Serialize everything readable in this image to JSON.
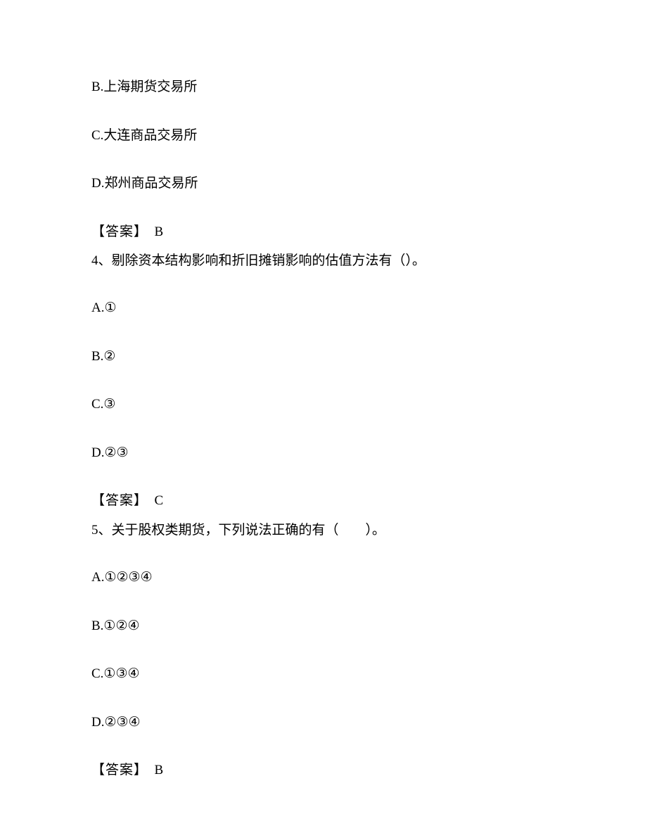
{
  "q3_remainder": {
    "options": {
      "b": "B.上海期货交易所",
      "c": "C.大连商品交易所",
      "d": "D.郑州商品交易所"
    },
    "answer_label": "【答案】",
    "answer_value": "B"
  },
  "q4": {
    "stem": "4、剔除资本结构影响和折旧摊销影响的估值方法有（）。",
    "options": {
      "a": "A.①",
      "b": "B.②",
      "c": "C.③",
      "d": "D.②③"
    },
    "answer_label": "【答案】",
    "answer_value": "C"
  },
  "q5": {
    "stem": "5、关于股权类期货，下列说法正确的有（　　）。",
    "options": {
      "a": "A.①②③④",
      "b": "B.①②④",
      "c": "C.①③④",
      "d": "D.②③④"
    },
    "answer_label": "【答案】",
    "answer_value": "B"
  }
}
